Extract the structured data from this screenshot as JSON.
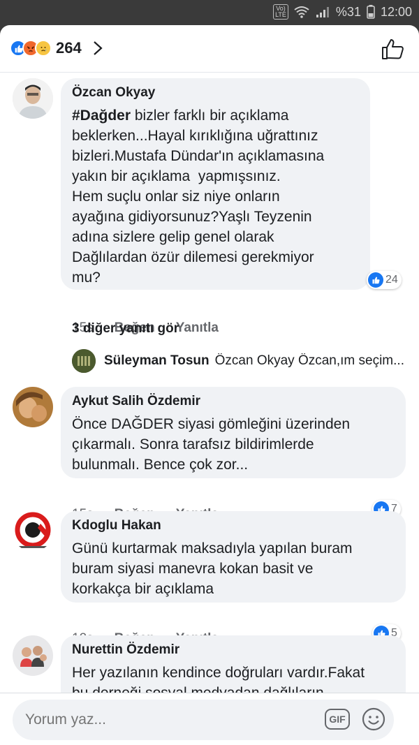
{
  "status_bar": {
    "network": "VoLTE",
    "battery": "%31",
    "time": "12:00"
  },
  "reactions": {
    "count": "264",
    "types": [
      "like-icon",
      "angry-icon",
      "sad-icon"
    ]
  },
  "comments": [
    {
      "author": "Özcan Okyay",
      "hashtag": "#Dağder",
      "text": " bizler farklı bir açıklama\nbeklerken...Hayal kırıklığına uğrattınız\nbizleri.Mustafa Dündar'ın açıklamasına\nyakın bir açıklama  yapmışsınız.\nHem suçlu onlar siz niye onların\nayağına gidiyorsunuz?Yaşlı Teyzenin\nadına sizlere gelip genel olarak\nDağlılardan özür dilemesi gerekmiyor\nmu?",
      "time": "15s",
      "like_label": "Beğen",
      "reply_label": "Yanıtla",
      "likes": "24"
    },
    {
      "author": "Aykut Salih Özdemir",
      "text": "Önce DAĞDER siyasi gömleğini üzerinden\nçıkarmalı. Sonra tarafsız bildirimlerde\nbulunmalı. Bence çok zor...",
      "time": "15s",
      "like_label": "Beğen",
      "reply_label": "Yanıtla",
      "likes": "7"
    },
    {
      "author": "Kdoglu Hakan",
      "text": "Günü kurtarmak maksadıyla yapılan buram\nburam siyasi manevra kokan basit ve\nkorkakça bir açıklama",
      "time": "12s",
      "like_label": "Beğen",
      "reply_label": "Yanıtla",
      "likes": "5"
    },
    {
      "author": "Nurettin Özdemir",
      "text": "Her yazılanın kendince doğruları vardır.Fakat\nbu derneği sosyal medyadan dağlıların"
    }
  ],
  "more_replies": "3 diğer yanıtı gör",
  "reply_preview": {
    "author": "Süleyman Tosun",
    "text": "Özcan Okyay Özcan,ım seçim..."
  },
  "composer": {
    "placeholder": "Yorum yaz...",
    "gif_label": "GIF"
  },
  "colors": {
    "accent": "#1877f2",
    "bubble": "#f0f2f5",
    "muted": "#65676b"
  }
}
